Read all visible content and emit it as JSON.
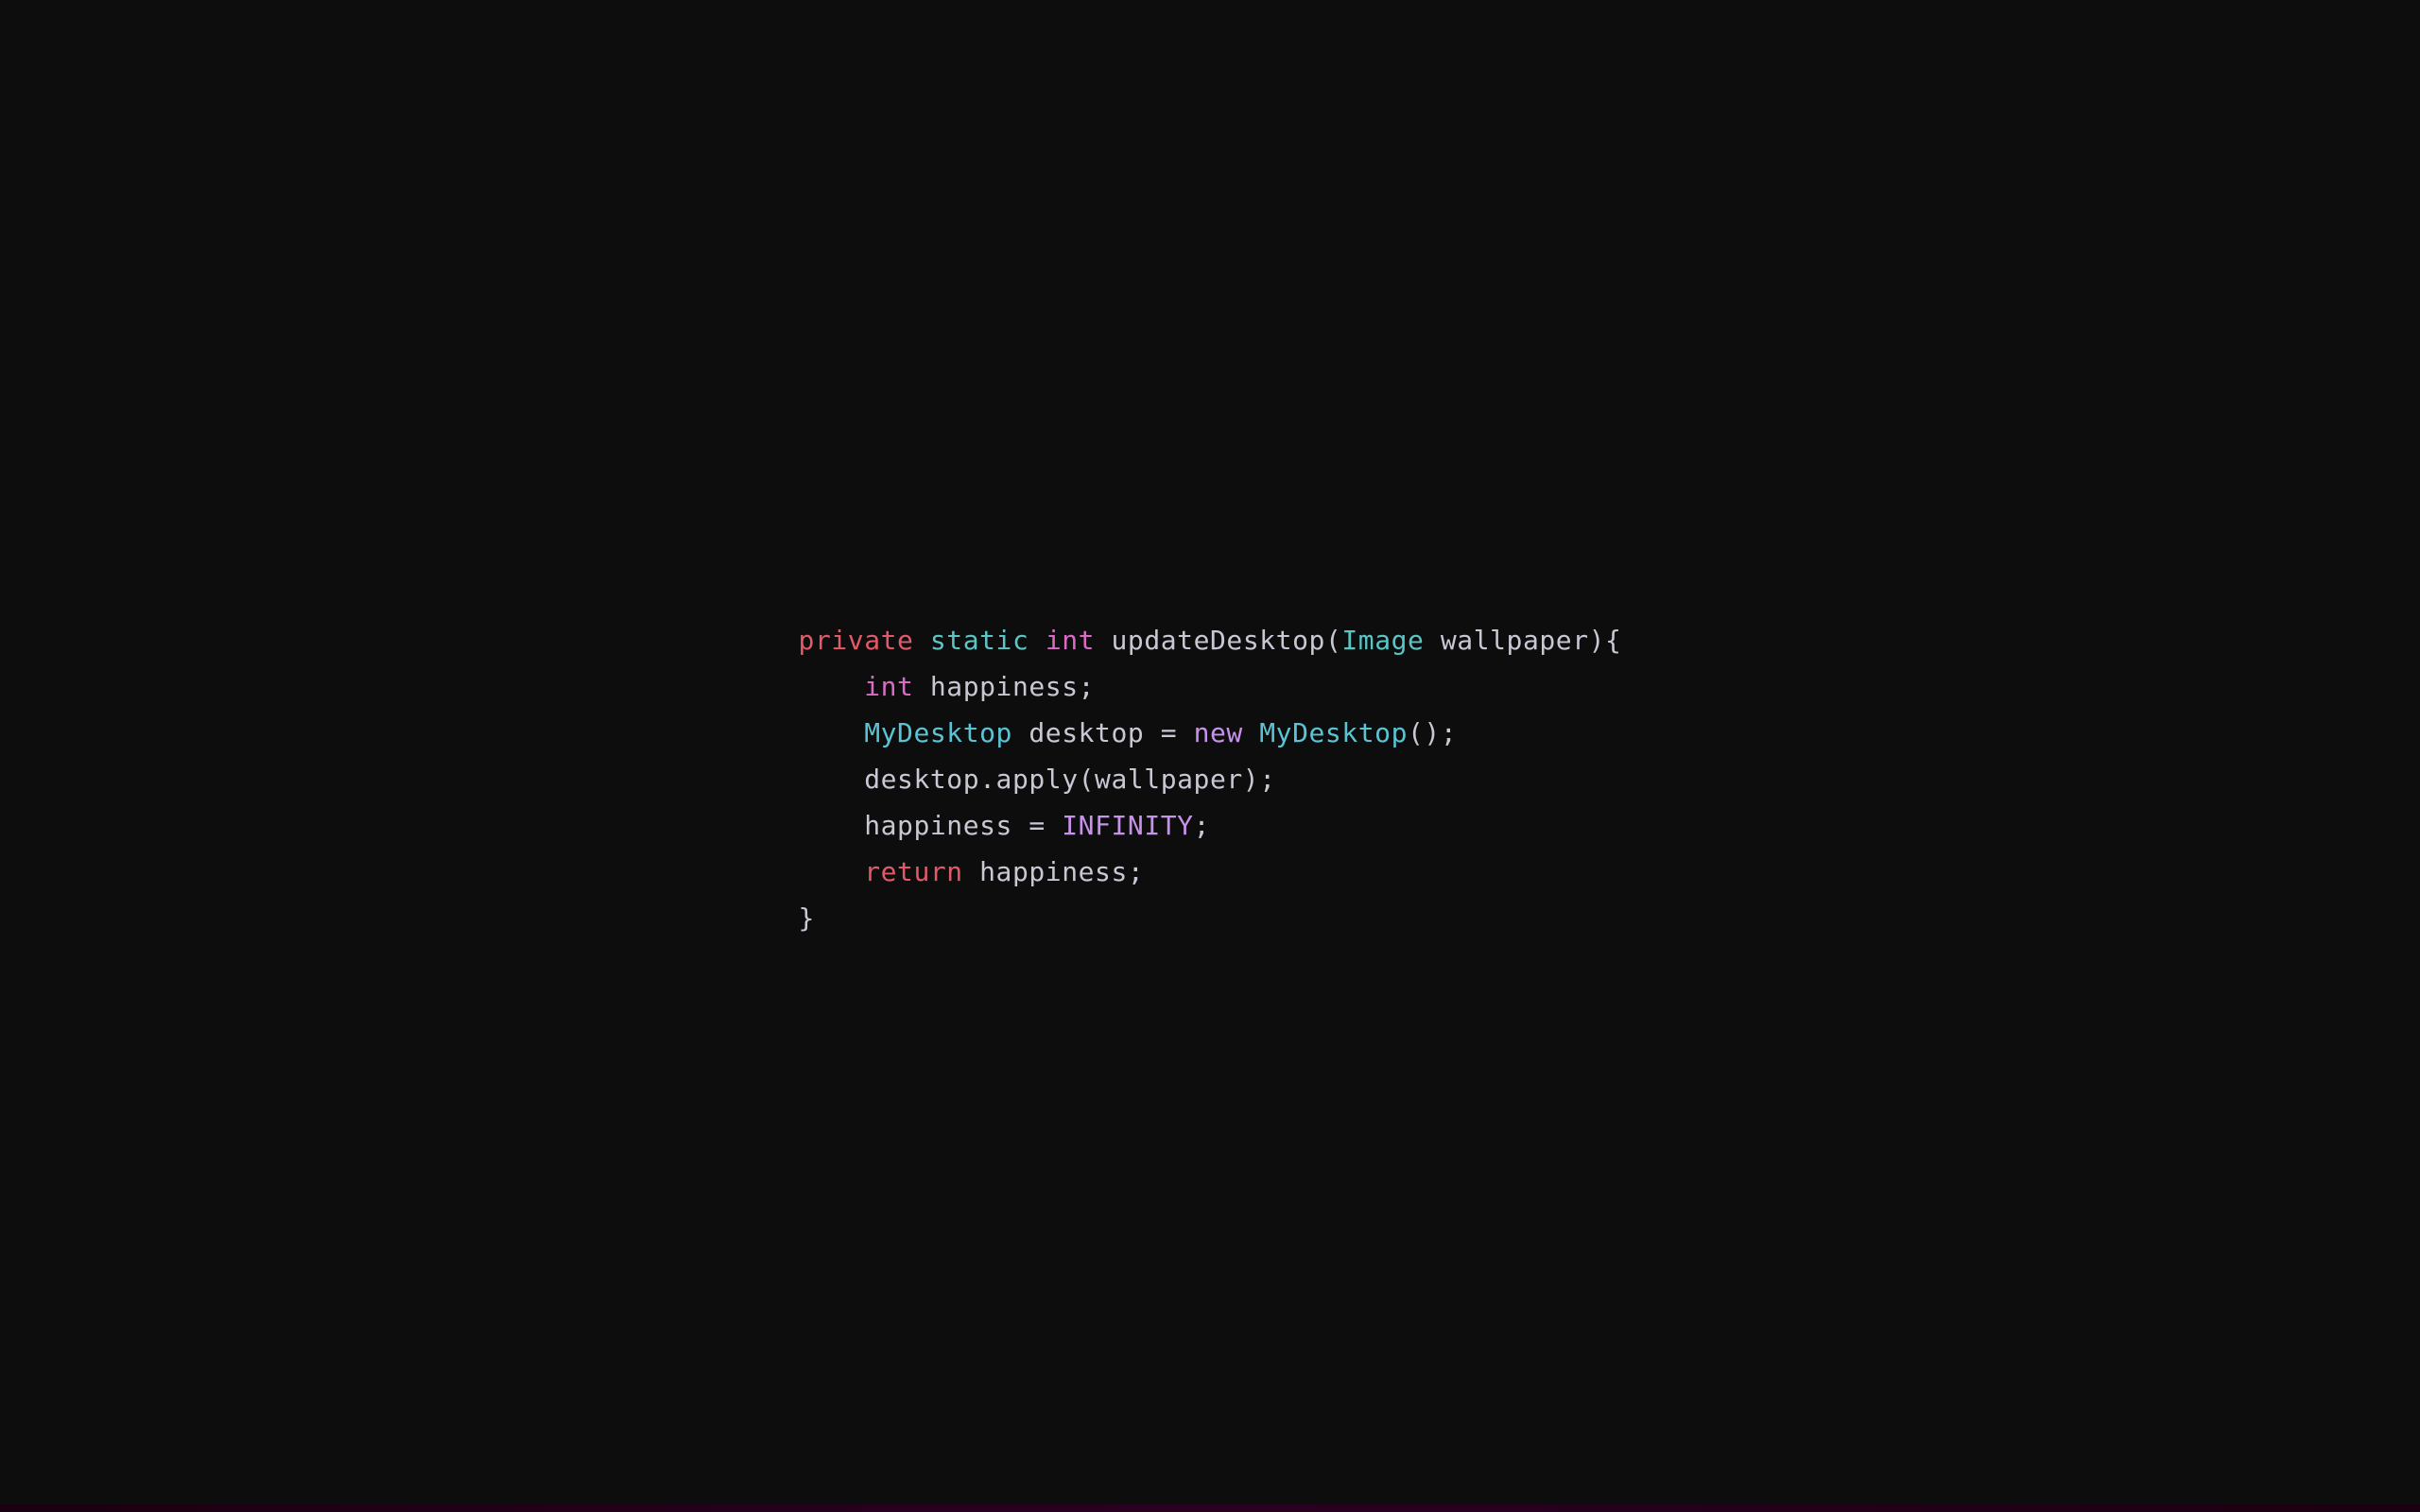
{
  "code": {
    "line1": {
      "kw_private": "private",
      "kw_static": "static",
      "kw_int": "int",
      "method": " updateDesktop(",
      "class_image": "Image",
      "param": " wallpaper){"
    },
    "line2": {
      "kw_int": "int",
      "rest": " happiness;"
    },
    "line3": {
      "class_mydesktop": "MyDesktop",
      "part1": " desktop = ",
      "kw_new": "new",
      "class_mydesktop2": " MyDesktop",
      "part2": "();"
    },
    "line4": {
      "text": "desktop.apply(wallpaper);"
    },
    "line5": {
      "var": "happiness",
      "eq": " = ",
      "const": "INFINITY",
      "semi": ";"
    },
    "line6": {
      "kw_return": "return",
      "rest": " happiness;"
    },
    "line7": {
      "text": "}"
    }
  }
}
